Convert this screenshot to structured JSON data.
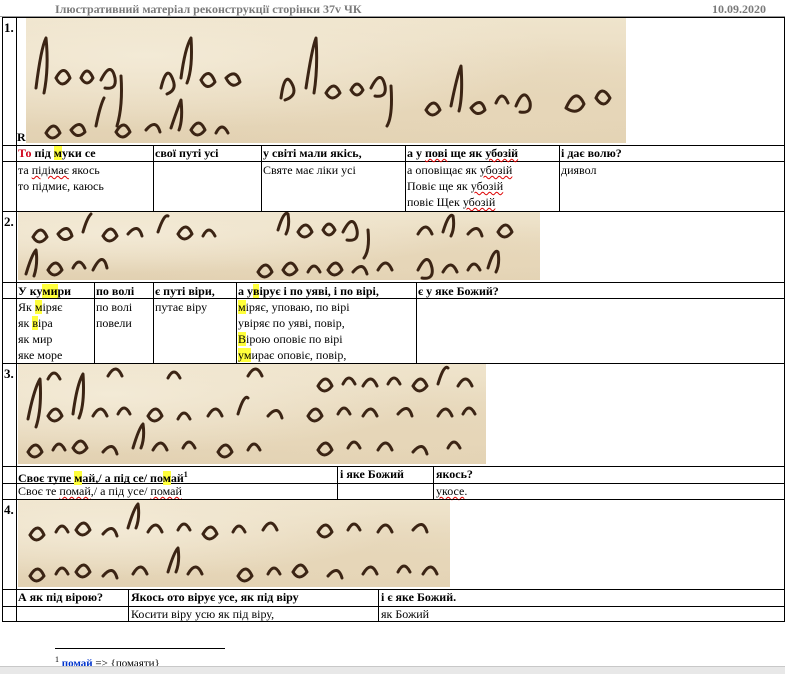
{
  "header": {
    "title": "Ілюстративний матеріал  реконструкції сторінки 37v ЧК",
    "date": "10.09.2020"
  },
  "sections": [
    {
      "number": "1.",
      "marker": "R",
      "headers": [
        "То під муки се",
        "свої путі усі",
        "у світі мали якісь,",
        "а у пові ще як убозій",
        "і дає волю?"
      ],
      "cells": [
        [
          "та підімає якось",
          "то підмиє, каюсь"
        ],
        [],
        [
          "Святе має ліки усі"
        ],
        [
          "а оповіщає як убозій",
          "Повіє ще як убозій",
          "повіє Щек убозій"
        ],
        [
          "диявол"
        ]
      ]
    },
    {
      "number": "2.",
      "headers": [
        "У кумири",
        "по волі",
        "є путі віри,",
        "а увірує і по уяві, і по вірі,",
        "є у яке Божий?"
      ],
      "cells": [
        [
          "Як міряє",
          "як віра",
          "як мир",
          "яке море"
        ],
        [
          "по волі",
          "повели"
        ],
        [
          "путає віру"
        ],
        [
          "міряє, уповаю, по вірі",
          "увіряє по уяві, повір,",
          "Вірою оповіє по вірі",
          "умирає оповіє, повір,"
        ],
        []
      ]
    },
    {
      "number": "3.",
      "headers": [
        "Своє тупе май,/ а під се/ помай",
        "і яке Божий",
        "якось?"
      ],
      "footnote_ref": "1",
      "cells": [
        [
          "Своє те помай,/ а під усе/ помай"
        ],
        [],
        [
          "укосе."
        ]
      ]
    },
    {
      "number": "4.",
      "headers": [
        "А як під вірою?",
        "Якось ото вірує усе, як під віру",
        "і є яке Божий."
      ],
      "cells": [
        [],
        [
          "Косити віру усю як під віру,"
        ],
        [
          "як Божий"
        ]
      ]
    }
  ],
  "footnote": {
    "mark": "1",
    "word": "помай",
    "text": " => {помаяти}"
  }
}
